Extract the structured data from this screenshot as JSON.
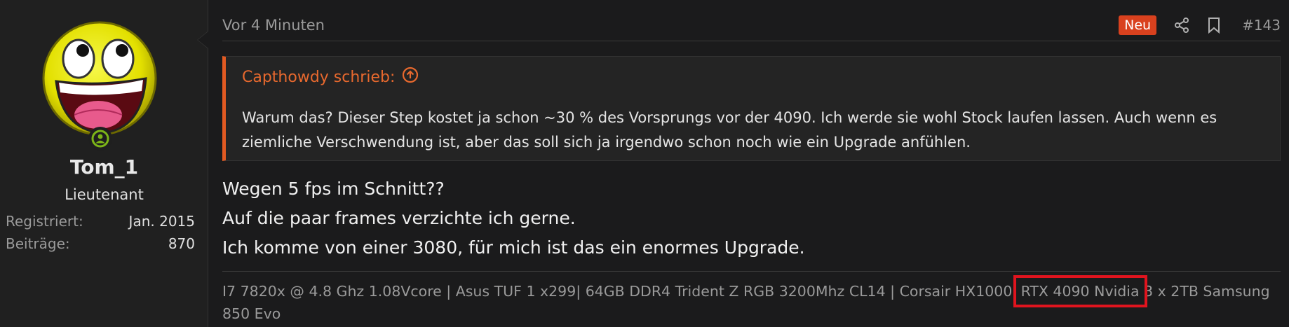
{
  "user": {
    "username": "Tom_1",
    "title": "Lieutenant",
    "stats": [
      {
        "label": "Registriert:",
        "value": "Jan. 2015"
      },
      {
        "label": "Beiträge:",
        "value": "870"
      }
    ],
    "avatar_icon": "awesome-face-avatar",
    "status_icon": "online-status-icon"
  },
  "meta": {
    "time": "Vor 4 Minuten",
    "new_badge": "Neu",
    "post_number": "#143",
    "share_icon": "share-icon",
    "bookmark_icon": "bookmark-icon"
  },
  "quote": {
    "author": "Capthowdy schrieb:",
    "jump_icon": "arrow-up-circle-icon",
    "text": "Warum das? Dieser Step kostet ja schon ~30 % des Vorsprungs vor der 4090. Ich werde sie wohl Stock laufen lassen. Auch wenn es ziemliche Verschwendung ist, aber das soll sich ja irgendwo schon noch wie ein Upgrade anfühlen."
  },
  "message": {
    "lines": [
      "Wegen 5 fps im Schnitt??",
      "Auf die paar frames verzichte ich gerne.",
      "Ich komme von einer 3080, für mich ist das ein enormes Upgrade."
    ]
  },
  "signature": {
    "part1": "I7 7820x @ 4.8 Ghz 1.08Vcore | Asus TUF 1 x299| 64GB DDR4 Trident Z RGB 3200Mhz CL14 | Corsair HX1000i ",
    "highlighted": "RTX 4090 Nvidia",
    "part2": " 3 x 2TB Samsung 850 Evo"
  },
  "colors": {
    "accent": "#e25a22",
    "badge": "#d9411e",
    "highlight_box": "#e0141e",
    "online": "#7cb518"
  }
}
